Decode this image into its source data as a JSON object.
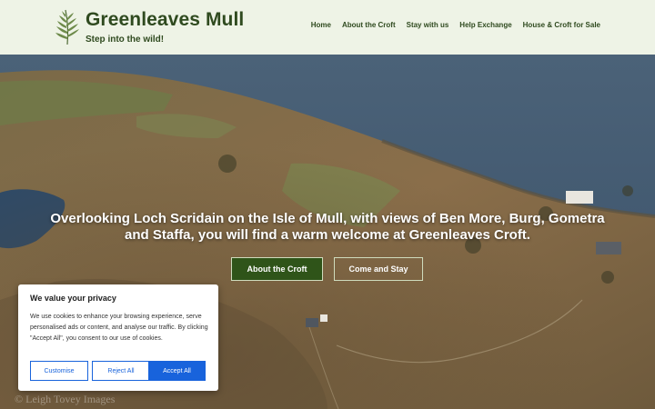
{
  "header": {
    "site_title": "Greenleaves Mull",
    "tagline": "Step into the wild!",
    "nav": [
      "Home",
      "About the Croft",
      "Stay with us",
      "Help Exchange",
      "House & Croft for Sale"
    ]
  },
  "hero": {
    "headline": "Overlooking Loch Scridain on the Isle of Mull, with views of Ben More, Burg, Gometra and Staffa, you will find a warm welcome at Greenleaves Croft.",
    "buttons": {
      "primary": "About the Croft",
      "secondary": "Come and Stay"
    },
    "watermark": "© Leigh Tovey Images"
  },
  "cookie": {
    "title": "We value your privacy",
    "body": "We use cookies to enhance your browsing experience, serve personalised ads or content, and analyse our traffic. By clicking \"Accept All\", you consent to our use of cookies.",
    "buttons": {
      "customise": "Customise",
      "reject": "Reject All",
      "accept": "Accept All"
    }
  },
  "colors": {
    "brand_green": "#2f4a1f",
    "header_bg": "#eef3e6",
    "button_green": "#2f5419",
    "cookie_blue": "#1863dc"
  },
  "icons": {
    "logo": "fern-leaf-icon"
  }
}
